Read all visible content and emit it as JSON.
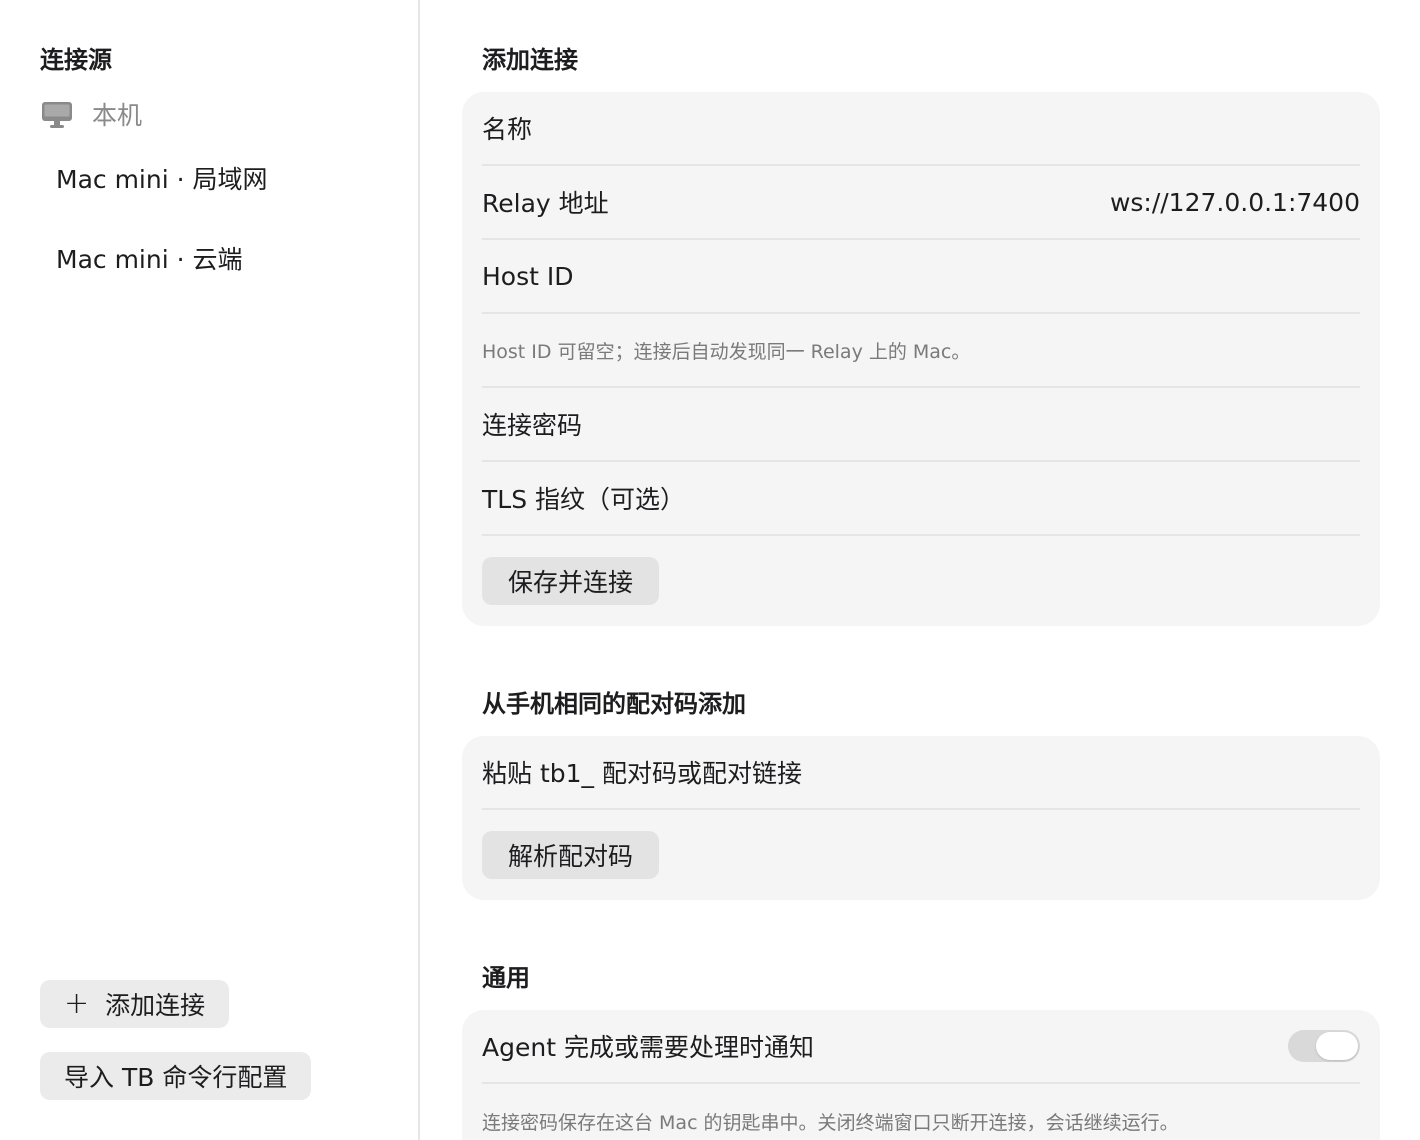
{
  "sidebar": {
    "title": "连接源",
    "local_label": "本机",
    "local_icon": "monitor-icon",
    "items": [
      {
        "label": "Mac mini · 局域网"
      },
      {
        "label": "Mac mini · 云端"
      }
    ],
    "add_button_label": "添加连接",
    "add_button_icon": "plus-icon",
    "import_button_label": "导入 TB 命令行配置"
  },
  "add_connection": {
    "title": "添加连接",
    "name_placeholder": "名称",
    "relay_label": "Relay 地址",
    "relay_value": "ws://127.0.0.1:7400",
    "host_id_placeholder": "Host ID",
    "host_id_hint": "Host ID 可留空；连接后自动发现同一 Relay 上的 Mac。",
    "password_placeholder": "连接密码",
    "tls_placeholder": "TLS 指纹（可选）",
    "save_button_label": "保存并连接"
  },
  "pairing": {
    "title": "从手机相同的配对码添加",
    "code_placeholder": "粘贴 tb1_ 配对码或配对链接",
    "parse_button_label": "解析配对码"
  },
  "general": {
    "title": "通用",
    "notify_label": "Agent 完成或需要处理时通知",
    "notify_enabled": false,
    "footnote": "连接密码保存在这台 Mac 的钥匙串中。关闭终端窗口只断开连接，会话继续运行。"
  }
}
